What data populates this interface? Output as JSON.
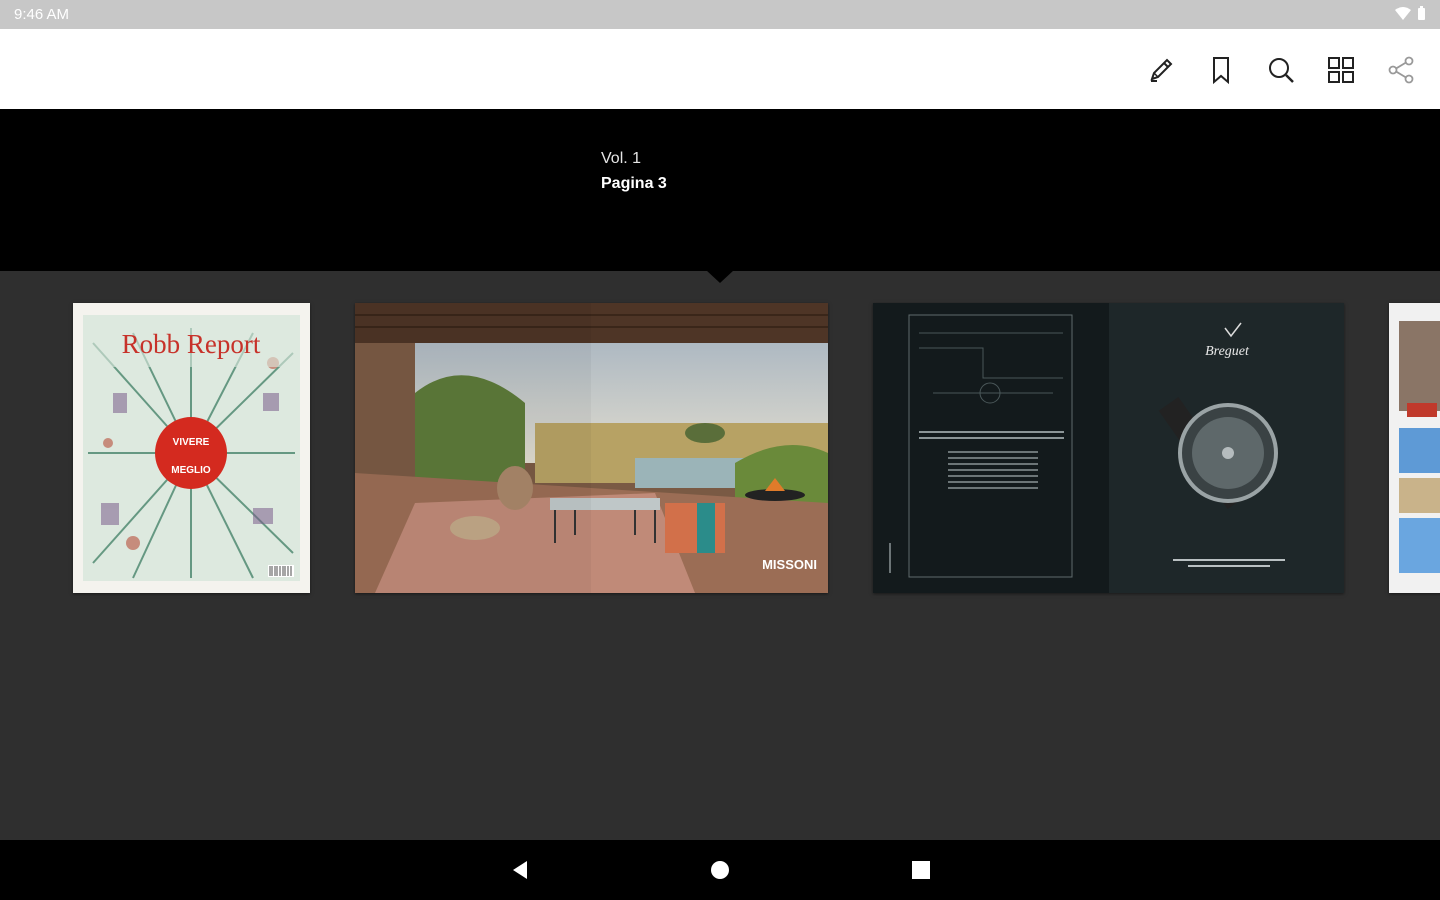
{
  "status_bar": {
    "time": "9:46 AM"
  },
  "toolbar": {
    "icons": [
      "edit-icon",
      "bookmark-icon",
      "search-icon",
      "grid-icon",
      "share-icon"
    ]
  },
  "info": {
    "volume": "Vol. 1",
    "page": "Pagina 3"
  },
  "thumbnails": {
    "cover": {
      "title": "Robb Report",
      "badge_line1": "VIVERE",
      "badge_line2": "MEGLIO"
    },
    "spread1": {
      "brand": "MISSONI"
    },
    "spread2": {
      "brand": "Breguet"
    }
  },
  "colors": {
    "accent_red": "#d42a1f",
    "background": "#2f2f2f",
    "band": "#000000"
  }
}
